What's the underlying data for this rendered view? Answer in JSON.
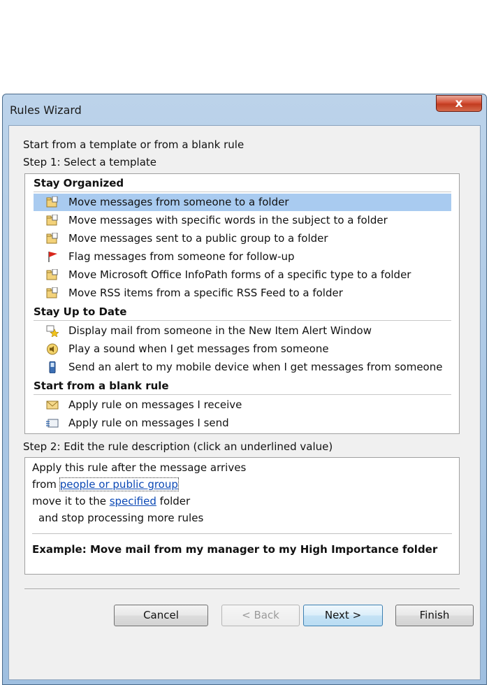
{
  "window": {
    "title": "Rules Wizard",
    "close_glyph": "x"
  },
  "intro": "Start from a template or from a blank rule",
  "step1": {
    "label": "Step 1: Select a template",
    "groups": [
      {
        "heading": "Stay Organized",
        "items": [
          {
            "label": "Move messages from someone to a folder",
            "icon": "folder-move-icon",
            "selected": true
          },
          {
            "label": "Move messages with specific words in the subject to a folder",
            "icon": "folder-move-icon"
          },
          {
            "label": "Move messages sent to a public group to a folder",
            "icon": "folder-move-icon"
          },
          {
            "label": "Flag messages from someone for follow-up",
            "icon": "red-flag-icon"
          },
          {
            "label": "Move Microsoft Office InfoPath forms of a specific type to a folder",
            "icon": "folder-move-icon"
          },
          {
            "label": "Move RSS items from a specific RSS Feed to a folder",
            "icon": "folder-move-icon"
          }
        ]
      },
      {
        "heading": "Stay Up to Date",
        "items": [
          {
            "label": "Display mail from someone in the New Item Alert Window",
            "icon": "alert-star-icon"
          },
          {
            "label": "Play a sound when I get messages from someone",
            "icon": "speaker-icon"
          },
          {
            "label": "Send an alert to my mobile device when I get messages from someone",
            "icon": "mobile-device-icon"
          }
        ]
      },
      {
        "heading": "Start from a blank rule",
        "items": [
          {
            "label": "Apply rule on messages I receive",
            "icon": "envelope-icon"
          },
          {
            "label": "Apply rule on messages I send",
            "icon": "send-envelope-icon"
          }
        ]
      }
    ]
  },
  "step2": {
    "label": "Step 2: Edit the rule description (click an underlined value)",
    "line1": "Apply this rule after the message arrives",
    "line2_prefix": "from ",
    "line2_link": "people or public group",
    "line3_prefix": "move it to the ",
    "line3_link": "specified",
    "line3_suffix": " folder",
    "line4": "and stop processing more rules",
    "example": "Example: Move mail from my manager to my High Importance folder"
  },
  "buttons": {
    "cancel": "Cancel",
    "back": "< Back",
    "next": "Next >",
    "finish": "Finish"
  }
}
